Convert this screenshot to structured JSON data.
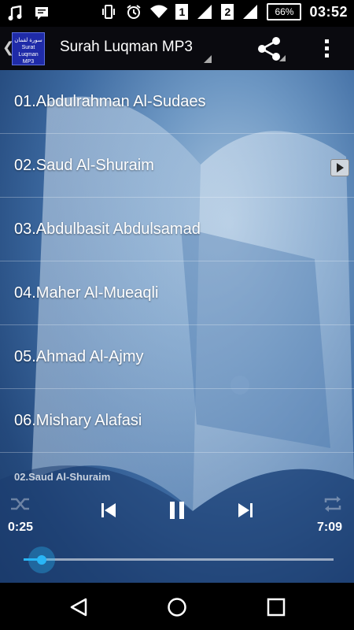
{
  "status_bar": {
    "sim1": "1",
    "sim2": "2",
    "battery": "66%",
    "time": "03:52",
    "icons": [
      "music-note-icon",
      "chat-icon",
      "vibrate-icon",
      "alarm-icon",
      "wifi-icon",
      "signal-icon",
      "battery-icon"
    ]
  },
  "action_bar": {
    "logo_lines": [
      "سورة لقمان",
      "Surat",
      "Luqman MP3"
    ],
    "title": "Surah Luqman MP3",
    "share_icon": "share-icon",
    "overflow_icon": "more-vert-icon"
  },
  "tracks": [
    {
      "label": "01.Abdulrahman Al-Sudaes"
    },
    {
      "label": "02.Saud Al-Shuraim"
    },
    {
      "label": "03.Abdulbasit Abdulsamad"
    },
    {
      "label": "04.Maher Al-Mueaqli"
    },
    {
      "label": "05.Ahmad Al-Ajmy"
    },
    {
      "label": "06.Mishary Alafasi"
    }
  ],
  "player": {
    "now_playing": "02.Saud Al-Shuraim",
    "elapsed": "0:25",
    "duration": "7:09",
    "progress": 0.058,
    "accent_color": "#29b6f6"
  },
  "nav_bar": {
    "icons": [
      "back-icon",
      "home-icon",
      "recents-icon"
    ]
  }
}
